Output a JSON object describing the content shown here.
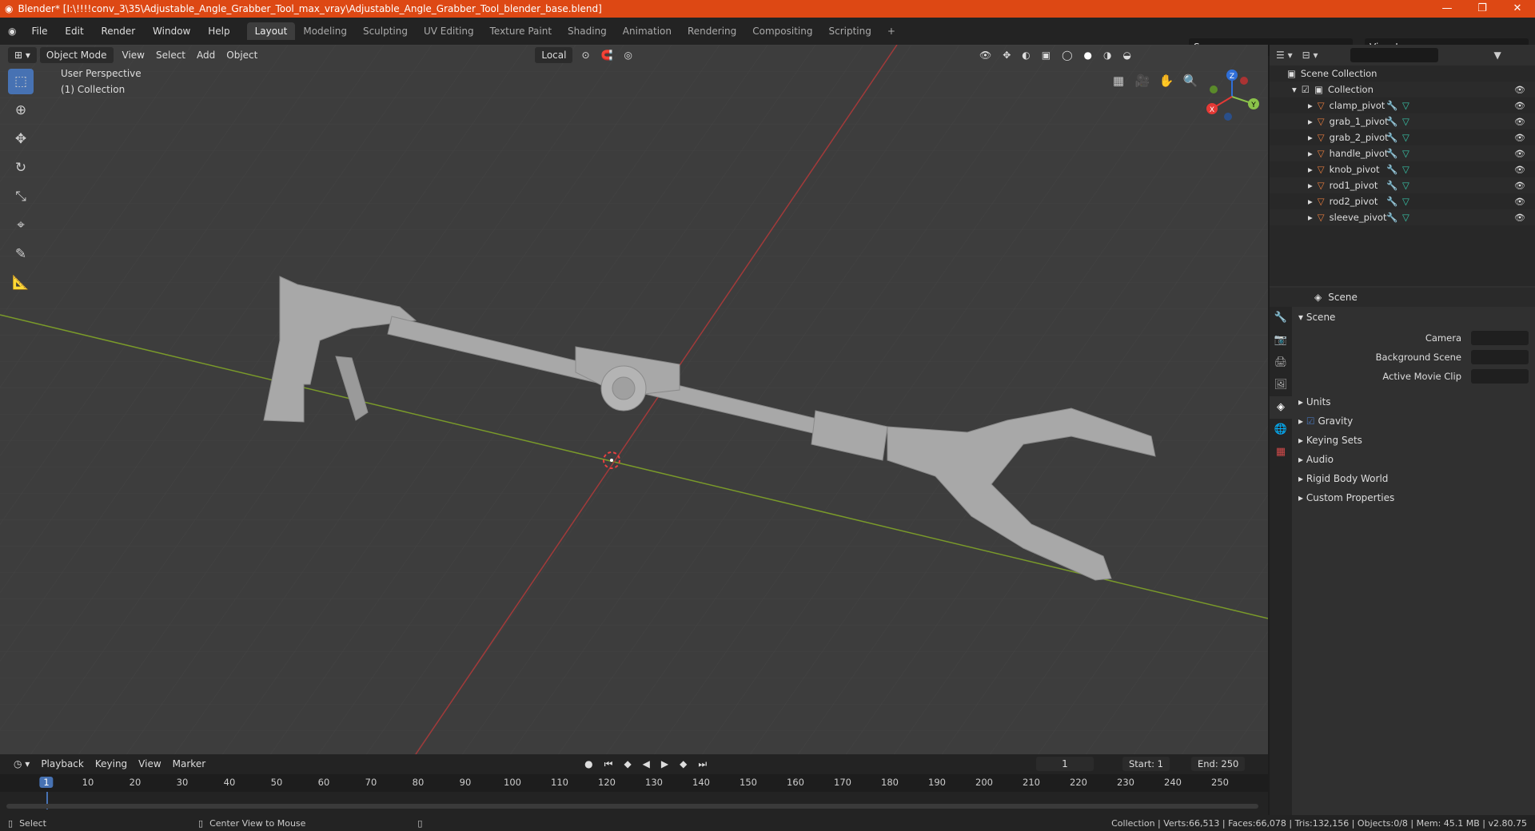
{
  "window": {
    "title": "Blender* [I:\\!!!!conv_3\\35\\Adjustable_Angle_Grabber_Tool_max_vray\\Adjustable_Angle_Grabber_Tool_blender_base.blend]",
    "minimize": "—",
    "maximize": "❐",
    "close": "✕"
  },
  "menu": [
    "File",
    "Edit",
    "Render",
    "Window",
    "Help"
  ],
  "workspaces": [
    "Layout",
    "Modeling",
    "Sculpting",
    "UV Editing",
    "Texture Paint",
    "Shading",
    "Animation",
    "Rendering",
    "Compositing",
    "Scripting"
  ],
  "scene": "Scene",
  "view_layer": "View Layer",
  "viewport": {
    "mode": "Object Mode",
    "menus": [
      "View",
      "Select",
      "Add",
      "Object"
    ],
    "transform_orientation": "Local",
    "perspective_label": "User Perspective",
    "collection_label": "(1) Collection",
    "gizmo": {
      "x": "X",
      "y": "Y",
      "z": "Z"
    }
  },
  "outliner": {
    "root": "Scene Collection",
    "collection": "Collection",
    "objects": [
      "clamp_pivot",
      "grab_1_pivot",
      "grab_2_pivot",
      "handle_pivot",
      "knob_pivot",
      "rod1_pivot",
      "rod2_pivot",
      "sleeve_pivot"
    ]
  },
  "properties": {
    "context": "Scene",
    "panel": "Scene",
    "camera_label": "Camera",
    "background_scene_label": "Background Scene",
    "active_movie_clip_label": "Active Movie Clip",
    "sections": [
      "Units",
      "Gravity",
      "Keying Sets",
      "Audio",
      "Rigid Body World",
      "Custom Properties"
    ]
  },
  "timeline": {
    "menus": [
      "Playback",
      "Keying",
      "View",
      "Marker"
    ],
    "current_frame": "1",
    "start_label": "Start:",
    "start": "1",
    "end_label": "End:",
    "end": "250",
    "frames": [
      "1",
      "10",
      "20",
      "30",
      "40",
      "50",
      "60",
      "70",
      "80",
      "90",
      "100",
      "110",
      "120",
      "130",
      "140",
      "150",
      "160",
      "170",
      "180",
      "190",
      "200",
      "210",
      "220",
      "230",
      "240",
      "250"
    ]
  },
  "status": {
    "left_action": "Select",
    "middle_action": "Center View to Mouse",
    "stats": "Collection | Verts:66,513 | Faces:66,078 | Tris:132,156 | Objects:0/8 | Mem: 45.1 MB | v2.80.75"
  }
}
